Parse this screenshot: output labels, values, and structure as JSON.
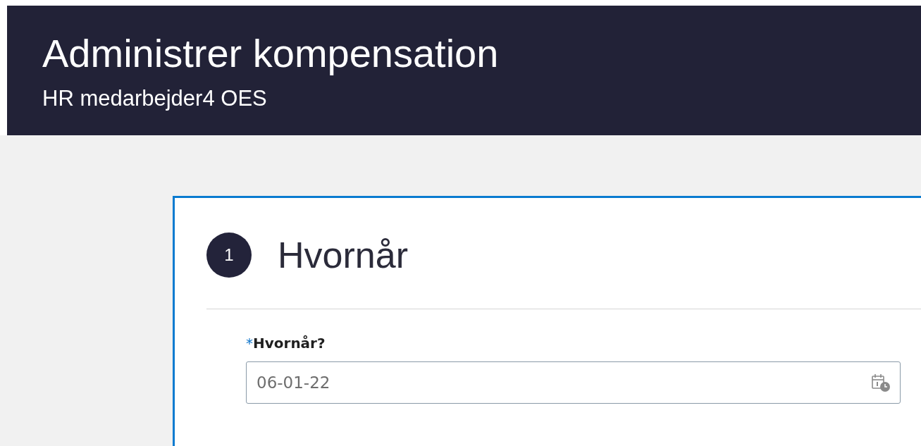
{
  "header": {
    "title": "Administrer kompensation",
    "subtitle": "HR medarbejder4 OES"
  },
  "section": {
    "step": "1",
    "title": "Hvornår",
    "field": {
      "required_mark": "*",
      "label": "Hvornår?",
      "value": "06-01-22"
    }
  }
}
